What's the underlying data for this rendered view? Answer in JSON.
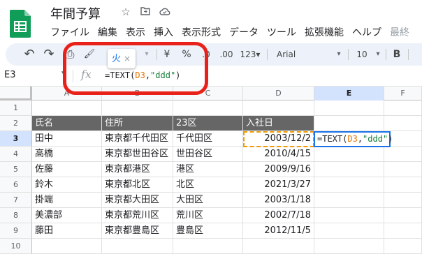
{
  "header": {
    "title": "年間予算",
    "icons": [
      "star-icon",
      "move-folder-icon",
      "cloud-status-icon"
    ]
  },
  "menu": [
    "ファイル",
    "編集",
    "表示",
    "挿入",
    "表示形式",
    "データ",
    "ツール",
    "拡張機能",
    "ヘルプ"
  ],
  "menu_faded": "最終",
  "toolbar": {
    "undo": "↶",
    "redo": "↷",
    "print": "⎙",
    "paint_format": "🖌",
    "currency": "¥",
    "percent": "%",
    "decimal_decrease": ".0",
    "decimal_increase": ".00",
    "more_formats": "123▾",
    "font": "Arial",
    "font_size": "10",
    "bold": "B"
  },
  "autocomplete_chip": {
    "text": "火",
    "close": "×"
  },
  "formula_bar": {
    "namebox": "E3",
    "fx": "fx",
    "formula_prefix": "=TEXT(",
    "formula_ref": "D3",
    "formula_sep": ",",
    "formula_str": "\"ddd\"",
    "formula_suffix": ")"
  },
  "columns": [
    "A",
    "B",
    "C",
    "D",
    "E",
    "F"
  ],
  "rows": [
    "1",
    "2",
    "3",
    "4",
    "5",
    "6",
    "7",
    "8",
    "9",
    "10"
  ],
  "table": {
    "headers": [
      "氏名",
      "住所",
      "23区",
      "入社日"
    ],
    "data": [
      [
        "田中",
        "東京都千代田区",
        "千代田区",
        "2003/12/2"
      ],
      [
        "高橋",
        "東京都世田谷区",
        "世田谷区",
        "2010/4/15"
      ],
      [
        "佐藤",
        "東京都港区",
        "港区",
        "2009/9/16"
      ],
      [
        "鈴木",
        "東京都北区",
        "北区",
        "2021/3/27"
      ],
      [
        "掛端",
        "東京都大田区",
        "大田区",
        "2003/1/18"
      ],
      [
        "美濃部",
        "東京都荒川区",
        "荒川区",
        "2002/7/18"
      ],
      [
        "藤田",
        "東京都豊島区",
        "豊島区",
        "2012/11/5"
      ]
    ]
  },
  "active_cell": {
    "prefix": "=TEXT(",
    "ref": "D3",
    "sep": ",",
    "str": "\"ddd\"",
    "suffix": ")"
  },
  "colors": {
    "header_fill": "#666666",
    "annotation": "#e8211a",
    "reference": "#e37400",
    "string": "#188038",
    "active": "#1a73e8"
  }
}
